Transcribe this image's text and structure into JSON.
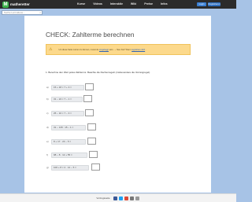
{
  "header": {
    "logo_mark": "M",
    "logo_text": "matheretter",
    "nav": [
      "Kurse",
      "Videos",
      "Interaktiv",
      "Wiki",
      "Preise",
      "Infos"
    ],
    "login_label": "Login",
    "register_label": "Registrieren"
  },
  "search": {
    "placeholder": "Suche Lernvideos..."
  },
  "main": {
    "title": "CHECK: Zahlterme berechnen",
    "notice": {
      "icon": "⚠",
      "text_before": "Um diese Seite nutzen zu können, musst du",
      "link1": "eingeloggt",
      "text_middle": "sein. → Neu hier? Dann",
      "link2": "registriere dich",
      "text_after": "."
    },
    "instruction": "1. Berechne den Wert jedes Zahlterms. Beachte die Rechenregeln (insbesondere die Vorrangregel).",
    "tasks": [
      {
        "num": "a)",
        "term": "15 + 18 × 7 + 3  ="
      },
      {
        "num": "b)",
        "term": "31 − 24 × 7 − 1  ="
      },
      {
        "num": "c)",
        "term": "25 − 16 × 7 − 3  ="
      },
      {
        "num": "d)",
        "term": "31 − 135 : 15 − 1  ="
      },
      {
        "num": "e)",
        "term": "8 + 17 · 23 − 5  ="
      },
      {
        "num": "f)",
        "term": "98 − 8 · 12 + 55  ="
      },
      {
        "num": "g)",
        "term": "100 + 8 × 2 · 12 − 5  ="
      }
    ]
  },
  "footer": {
    "label": "Vorzugsseite"
  },
  "colors": {
    "nav_bg": "#2b2b2b",
    "page_bg": "#a7c3e6",
    "notice_bg": "#fcd98c",
    "accent": "#3a7fd3",
    "logo": "#3fb34f"
  }
}
